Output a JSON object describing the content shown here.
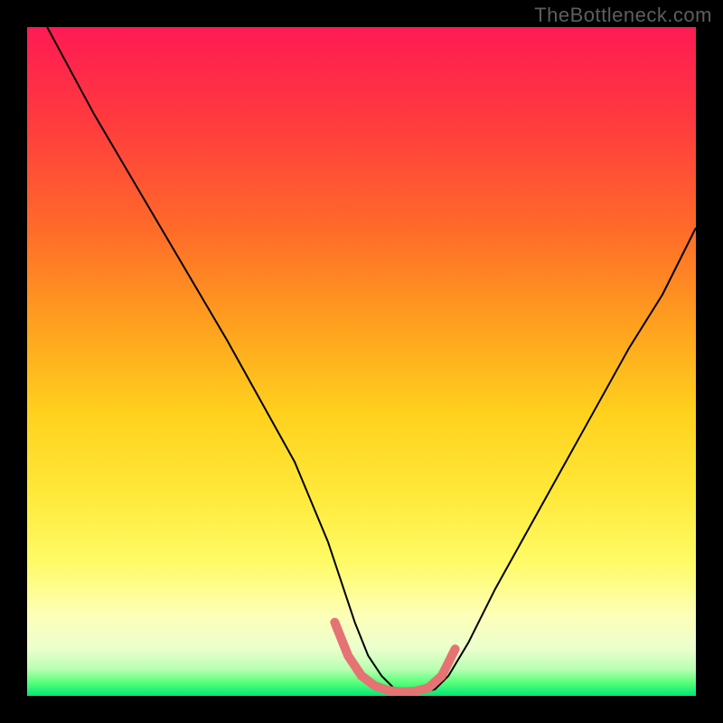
{
  "watermark": "TheBottleneck.com",
  "chart_data": {
    "type": "line",
    "title": "",
    "xlabel": "",
    "ylabel": "",
    "xlim": [
      0,
      100
    ],
    "ylim": [
      0,
      100
    ],
    "series": [
      {
        "name": "primary-curve",
        "color": "#000000",
        "stroke_width": 2,
        "x": [
          3,
          10,
          20,
          30,
          40,
          45,
          47,
          49,
          51,
          53,
          55,
          57,
          59,
          61,
          63,
          66,
          70,
          75,
          80,
          85,
          90,
          95,
          100
        ],
        "y": [
          100,
          87,
          70,
          53,
          35,
          23,
          17,
          11,
          6,
          3,
          1,
          0.5,
          0.5,
          1,
          3,
          8,
          16,
          25,
          34,
          43,
          52,
          60,
          70
        ]
      },
      {
        "name": "optimal-zone",
        "color": "#e57373",
        "stroke_width": 10,
        "x": [
          46,
          48,
          50,
          52,
          54,
          56,
          58,
          60,
          62,
          64
        ],
        "y": [
          11,
          6,
          3,
          1.5,
          0.8,
          0.6,
          0.7,
          1.2,
          3,
          7
        ]
      }
    ],
    "gradient_stops": [
      {
        "pos": 0.0,
        "color": "#ff1a54"
      },
      {
        "pos": 0.15,
        "color": "#ff3d3d"
      },
      {
        "pos": 0.3,
        "color": "#ff6a2a"
      },
      {
        "pos": 0.45,
        "color": "#ffa21e"
      },
      {
        "pos": 0.58,
        "color": "#ffd21e"
      },
      {
        "pos": 0.7,
        "color": "#ffe93a"
      },
      {
        "pos": 0.8,
        "color": "#fffb66"
      },
      {
        "pos": 0.88,
        "color": "#fdffb8"
      },
      {
        "pos": 0.93,
        "color": "#ebffcc"
      },
      {
        "pos": 0.96,
        "color": "#b8ffb2"
      },
      {
        "pos": 0.98,
        "color": "#59ff7a"
      },
      {
        "pos": 1.0,
        "color": "#00e676"
      }
    ]
  }
}
